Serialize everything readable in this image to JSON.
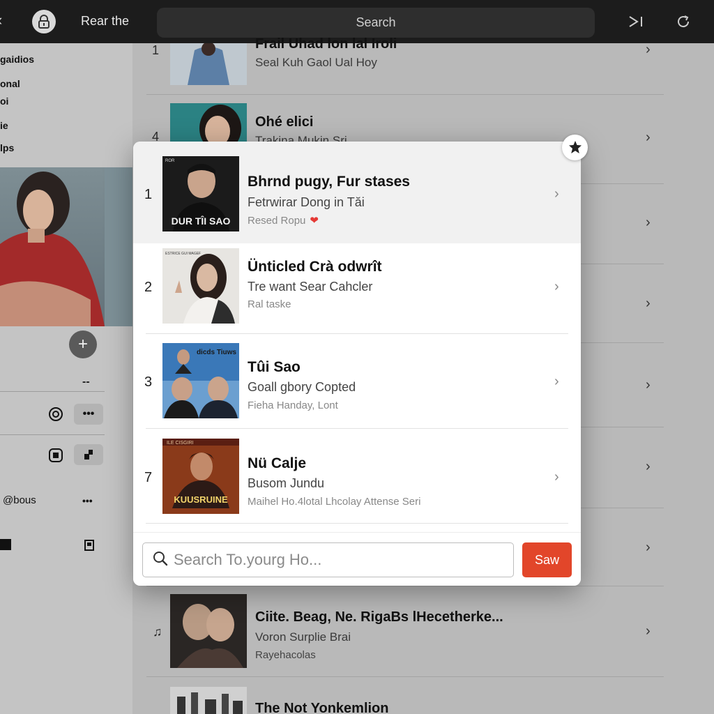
{
  "topbar": {
    "title": "Rear the",
    "search_placeholder": "Search"
  },
  "sidebar": {
    "links": [
      "gaidios",
      "onal",
      "oi",
      "ie",
      "lps"
    ],
    "dash": "--",
    "more": "•••",
    "bonus_label": "@bous",
    "bonus_more": "•••"
  },
  "background_list": [
    {
      "num": "1",
      "title": "Frail Uhad lon lal Iroli",
      "subtitle": "Seal Kuh Gaol Ual Hoy",
      "meta": ""
    },
    {
      "num": "4",
      "title": "Ohé elici",
      "subtitle": "Trakina Mukin Sri",
      "meta": ""
    },
    {
      "num": "",
      "title": "Ciite. Beag, Ne. RigaBs lHecetherke...",
      "subtitle": "Voron Surplie Brai",
      "meta": "Rayehacolas"
    },
    {
      "num": "",
      "title": "The Not Yonkemlion",
      "subtitle": "",
      "meta": ""
    }
  ],
  "modal": {
    "items": [
      {
        "num": "1",
        "title": "Bhrnd pugy, Fur stases",
        "subtitle": "Fetrwirar Dong in Tăi",
        "meta": "Resed Ropu",
        "cover_text": "DUR TÎI SAO",
        "cover_tag": "ROR",
        "liked": true
      },
      {
        "num": "2",
        "title": "Ünticled Crà odwrît",
        "subtitle": "Tre want Sear Cahcler",
        "meta": "Ral taske",
        "cover_text": "ESTRICE GUI MAGEF"
      },
      {
        "num": "3",
        "title": "Tûi Sao",
        "subtitle": "Goall gbory Copted",
        "meta": "Fieha Handay, Lont",
        "cover_text": "dicds Tiuws"
      },
      {
        "num": "7",
        "title": "Nü Calje",
        "subtitle": "Busom Jundu",
        "meta": "Maihel Ho.4lotal Lhcolay Attense Seri",
        "cover_text": "KUUSRUINE",
        "cover_tag": "ILE CISGIRI"
      }
    ],
    "search": {
      "placeholder": "Search To.yourg Ho...",
      "value": ""
    },
    "save_label": "Saw"
  },
  "colors": {
    "accent": "#e2462a",
    "heart": "#e53935",
    "topbar": "#1c1c1c",
    "overlay": "#b9b9b9"
  },
  "icons": {
    "lock": "lock-icon",
    "skip": "skip-icon",
    "refresh": "refresh-icon",
    "star": "star-badge-icon",
    "search": "search-icon",
    "chevron": "chevron-right-icon"
  }
}
